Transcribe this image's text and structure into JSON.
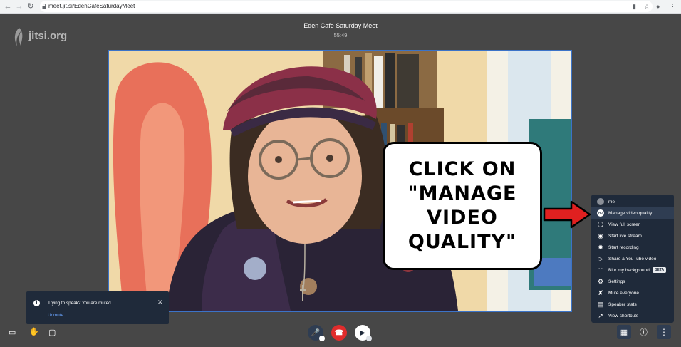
{
  "browser": {
    "url": "meet.jit.si/EdenCafeSaturdayMeet",
    "icons": {
      "back": "back-arrow-icon",
      "forward": "forward-arrow-icon",
      "reload": "reload-icon",
      "lock": "lock-icon",
      "camera": "camera-icon",
      "star": "star-icon",
      "account": "account-icon",
      "menu": "kebab-menu-icon"
    }
  },
  "app": {
    "logo_text": "jitsi.org",
    "meeting_title": "Eden Cafe Saturday Meet",
    "timer": "55:49"
  },
  "callout": {
    "text": "CLICK ON\n\"MANAGE\nVIDEO\nQUALITY\""
  },
  "menu": {
    "items": [
      {
        "label": "me",
        "icon": "avatar-icon"
      },
      {
        "label": "Manage video quality",
        "icon": "hd-icon"
      },
      {
        "label": "View full screen",
        "icon": "fullscreen-icon"
      },
      {
        "label": "Start live stream",
        "icon": "live-stream-icon"
      },
      {
        "label": "Start recording",
        "icon": "recording-icon"
      },
      {
        "label": "Share a YouTube video",
        "icon": "youtube-play-icon"
      },
      {
        "label": "Blur my background",
        "icon": "blur-icon",
        "badge": "BETA"
      },
      {
        "label": "Settings",
        "icon": "gear-icon"
      },
      {
        "label": "Mute everyone",
        "icon": "mute-everyone-icon"
      },
      {
        "label": "Speaker stats",
        "icon": "stats-icon"
      },
      {
        "label": "View shortcuts",
        "icon": "shortcut-icon"
      }
    ]
  },
  "notification": {
    "message": "Trying to speak? You are muted.",
    "action": "Unmute"
  },
  "colors": {
    "background": "#474747",
    "panel": "#1f2a3a",
    "hangup": "#e02c2c",
    "video_border": "#3b73c8",
    "arrow": "#e02020"
  }
}
